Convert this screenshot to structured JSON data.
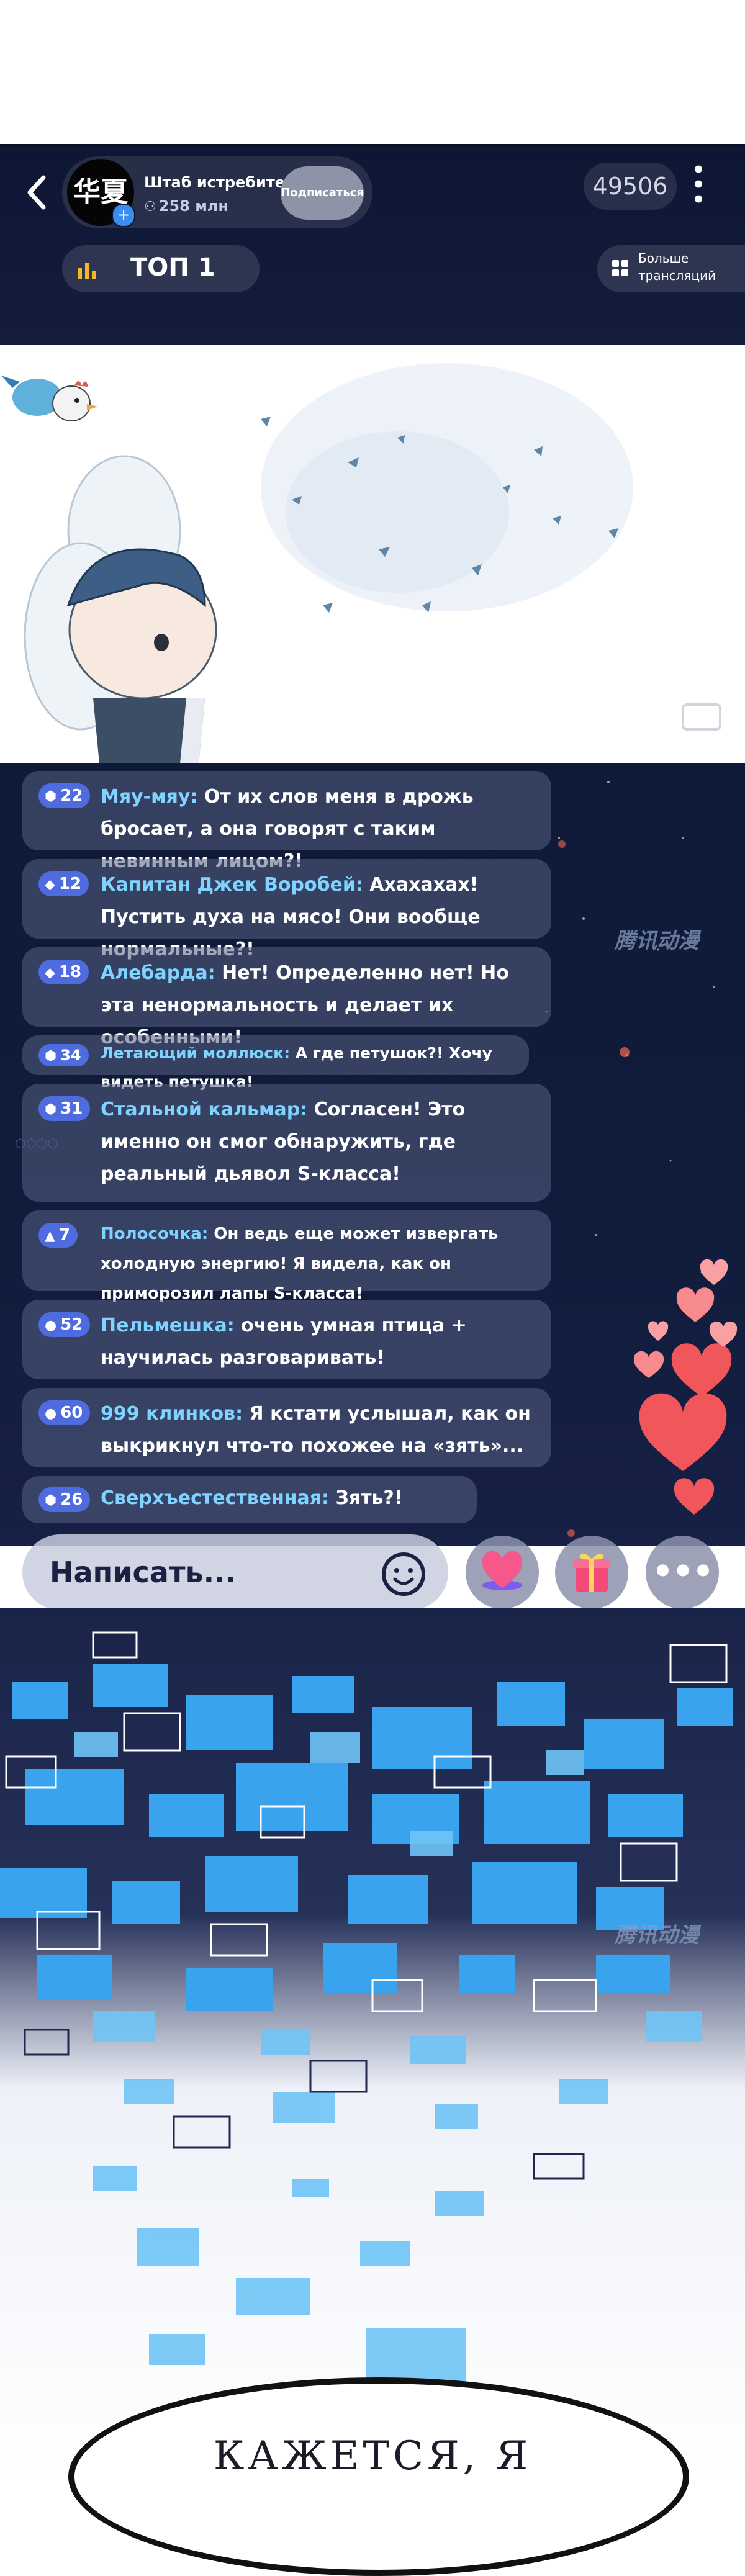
{
  "header": {
    "back_icon": "chevron-left-icon",
    "host_name": "Штаб истребителей",
    "avatar_text": "华夏",
    "viewers": "258 млн",
    "viewers_icon": "people-icon",
    "subscribe_label": "Подписаться",
    "viewer_count": "49506",
    "more_icon": "vertical-dots-icon",
    "top_label": "ТОП 1",
    "top_icon": "bar-chart-icon",
    "more_streams_label": "Больше трансляций",
    "more_streams_icon": "grid-icon"
  },
  "chat": {
    "messages": [
      {
        "level": "22",
        "user": "Мяу-мяу:",
        "text": " От их слов меня в дрожь бросает, а она говорят с таким невинным лицом?!"
      },
      {
        "level": "12",
        "user": "Капитан Джек Воробей:",
        "text": " Ахахахах! Пустить духа на мясо! Они вообще нормальные?!"
      },
      {
        "level": "18",
        "user": "Алебарда:",
        "text": " Нет! Определенно нет! Но эта ненормальность и делает их особенными!"
      },
      {
        "level": "34",
        "user": "Летающий моллюск:",
        "text": " А где петушок?! Хочу видеть петушка!"
      },
      {
        "level": "31",
        "user": "Стальной кальмар:",
        "text": " Согласен! Это именно он смог обнаружить, где реальный дьявол S-класса!"
      },
      {
        "level": "7",
        "user": "Полосочка:",
        "text": " Он ведь еще может извергать холодную энергию! Я видела, как он приморозил лапы S-класса!"
      },
      {
        "level": "52",
        "user": "Пельмешка:",
        "text": " очень умная птица + научилась разговаривать!"
      },
      {
        "level": "60",
        "user": "999 клинков:",
        "text": " Я кстати услышал, как он выкрикнул что-то похожее на «зять»..."
      },
      {
        "level": "26",
        "user": "Сверхъестественная:",
        "text": " Зять?!"
      }
    ],
    "input_placeholder": "Написать...",
    "emoji_icon": "smiley-icon",
    "like_icon": "heart-icon",
    "gift_icon": "gift-icon",
    "more_label": "•••"
  },
  "watermarks": [
    "腾讯动漫",
    "腾讯动漫"
  ],
  "caption": "КАЖЕТСЯ, Я",
  "colors": {
    "header_bg": "#0d1633",
    "username": "#7fd3ff",
    "level_badge": "#4f6be0",
    "heart": "#f0565a"
  }
}
